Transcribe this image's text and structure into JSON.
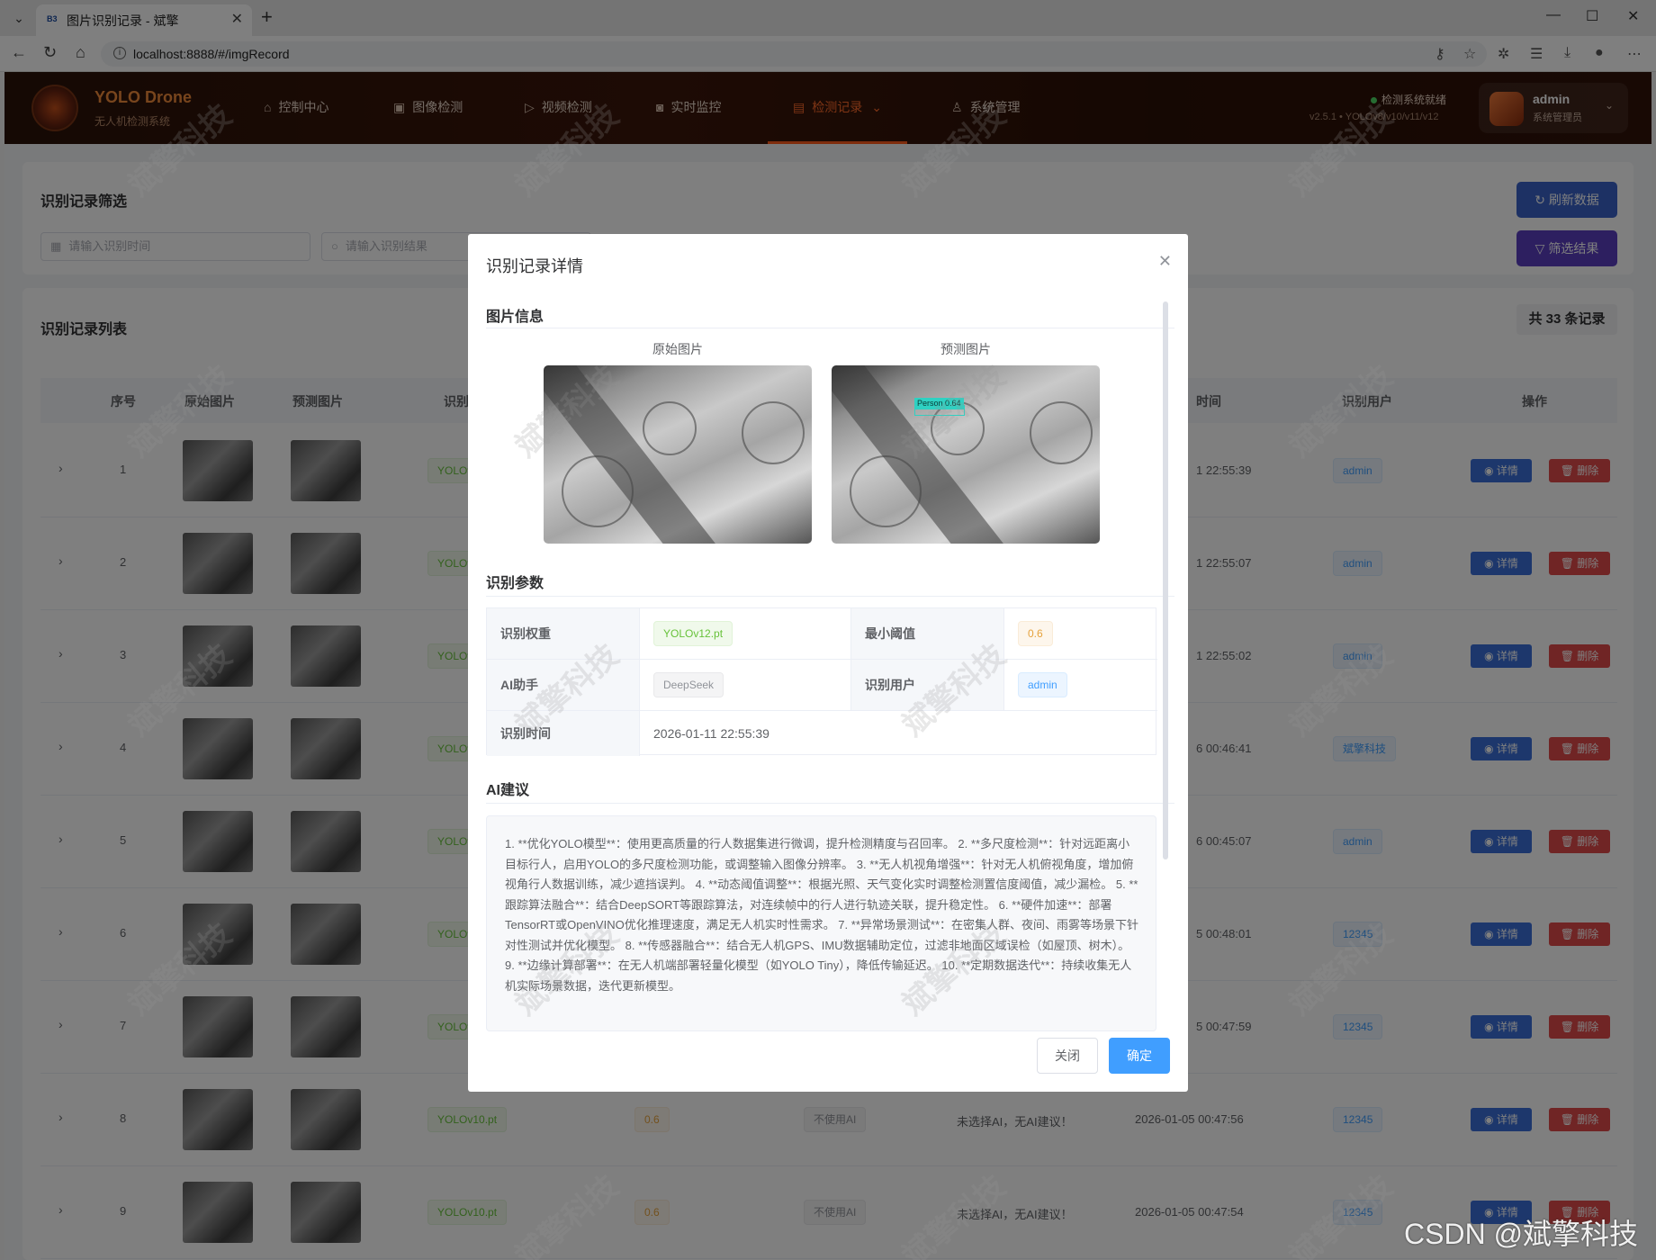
{
  "browser": {
    "tab_title": "图片识别记录 - 斌擎",
    "favicon_text": "B3",
    "url": "localhost:8888/#/imgRecord"
  },
  "header": {
    "brand": "YOLO Drone",
    "brand_sub": "无人机检测系统",
    "nav": [
      {
        "label": "控制中心",
        "icon": "home-icon"
      },
      {
        "label": "图像检测",
        "icon": "image-icon"
      },
      {
        "label": "视频检测",
        "icon": "play-icon"
      },
      {
        "label": "实时监控",
        "icon": "camera-icon"
      },
      {
        "label": "检测记录",
        "icon": "document-icon"
      },
      {
        "label": "系统管理",
        "icon": "user-icon"
      }
    ],
    "status": "检测系统就绪",
    "version": "v2.5.1 • YOLOv8/v10/v11/v12",
    "user_name": "admin",
    "user_role": "系统管理员"
  },
  "filter": {
    "title": "识别记录筛选",
    "time_placeholder": "请输入识别时间",
    "result_placeholder": "请输入识别结果",
    "refresh_label": "刷新数据",
    "filter_label": "筛选结果"
  },
  "list": {
    "title": "识别记录列表",
    "count_label": "共 33 条记录",
    "columns": [
      "序号",
      "原始图片",
      "预测图片",
      "识别",
      "时间",
      "识别用户",
      "操作"
    ],
    "rows": [
      {
        "index": "1",
        "model": "YOLOv",
        "time": "1 22:55:39",
        "user": "admin"
      },
      {
        "index": "2",
        "model": "YOLOv",
        "time": "1 22:55:07",
        "user": "admin"
      },
      {
        "index": "3",
        "model": "YOLOv",
        "time": "1 22:55:02",
        "user": "admin"
      },
      {
        "index": "4",
        "model": "YOLOv",
        "time": "6 00:46:41",
        "user": "斌擎科技"
      },
      {
        "index": "5",
        "model": "YOLOv",
        "time": "6 00:45:07",
        "user": "admin"
      },
      {
        "index": "6",
        "model": "YOLOv",
        "time": "5 00:48:01",
        "user": "12345"
      },
      {
        "index": "7",
        "model": "YOLOv",
        "time": "5 00:47:59",
        "user": "12345"
      },
      {
        "index": "8",
        "model": "YOLOv10.pt",
        "conf": "0.6",
        "ai": "不使用AI",
        "suggest": "未选择AI，无AI建议！",
        "time": "2026-01-05 00:47:56",
        "user": "12345"
      },
      {
        "index": "9",
        "model": "YOLOv10.pt",
        "conf": "0.6",
        "ai": "不使用AI",
        "suggest": "未选择AI，无AI建议！",
        "time": "2026-01-05 00:47:54",
        "user": "12345"
      }
    ],
    "detail_label": "详情",
    "delete_label": "删除"
  },
  "dialog": {
    "title": "识别记录详情",
    "section_image": "图片信息",
    "original_caption": "原始图片",
    "predicted_caption": "预测图片",
    "detection_label": "Person 0.64",
    "section_params": "识别参数",
    "params": {
      "weight_label": "识别权重",
      "weight_value": "YOLOv12.pt",
      "threshold_label": "最小阈值",
      "threshold_value": "0.6",
      "ai_label": "AI助手",
      "ai_value": "DeepSeek",
      "user_label": "识别用户",
      "user_value": "admin",
      "time_label": "识别时间",
      "time_value": "2026-01-11 22:55:39"
    },
    "section_ai": "AI建议",
    "ai_text": "1. **优化YOLO模型**：使用更高质量的行人数据集进行微调，提升检测精度与召回率。 2. **多尺度检测**：针对远距离小目标行人，启用YOLO的多尺度检测功能，或调整输入图像分辨率。 3. **无人机视角增强**：针对无人机俯视角度，增加俯视角行人数据训练，减少遮挡误判。 4. **动态阈值调整**：根据光照、天气变化实时调整检测置信度阈值，减少漏检。 5. **跟踪算法融合**：结合DeepSORT等跟踪算法，对连续帧中的行人进行轨迹关联，提升稳定性。 6. **硬件加速**：部署TensorRT或OpenVINO优化推理速度，满足无人机实时性需求。 7. **异常场景测试**：在密集人群、夜间、雨雾等场景下针对性测试并优化模型。 8. **传感器融合**：结合无人机GPS、IMU数据辅助定位，过滤非地面区域误检（如屋顶、树木）。 9. **边缘计算部署**：在无人机端部署轻量化模型（如YOLO Tiny），降低传输延迟。 10. **定期数据迭代**：持续收集无人机实际场景数据，迭代更新模型。",
    "close_label": "关闭",
    "confirm_label": "确定"
  },
  "watermark": "斌擎科技",
  "csdn_watermark": "CSDN @斌擎科技",
  "colors": {
    "accent": "#ff5a1a",
    "primary": "#409eff",
    "refresh_button": "#3a62c9",
    "filter_button": "#5a3fc0",
    "detail_button": "#3a6fd8",
    "delete_button": "#e04a4a"
  }
}
